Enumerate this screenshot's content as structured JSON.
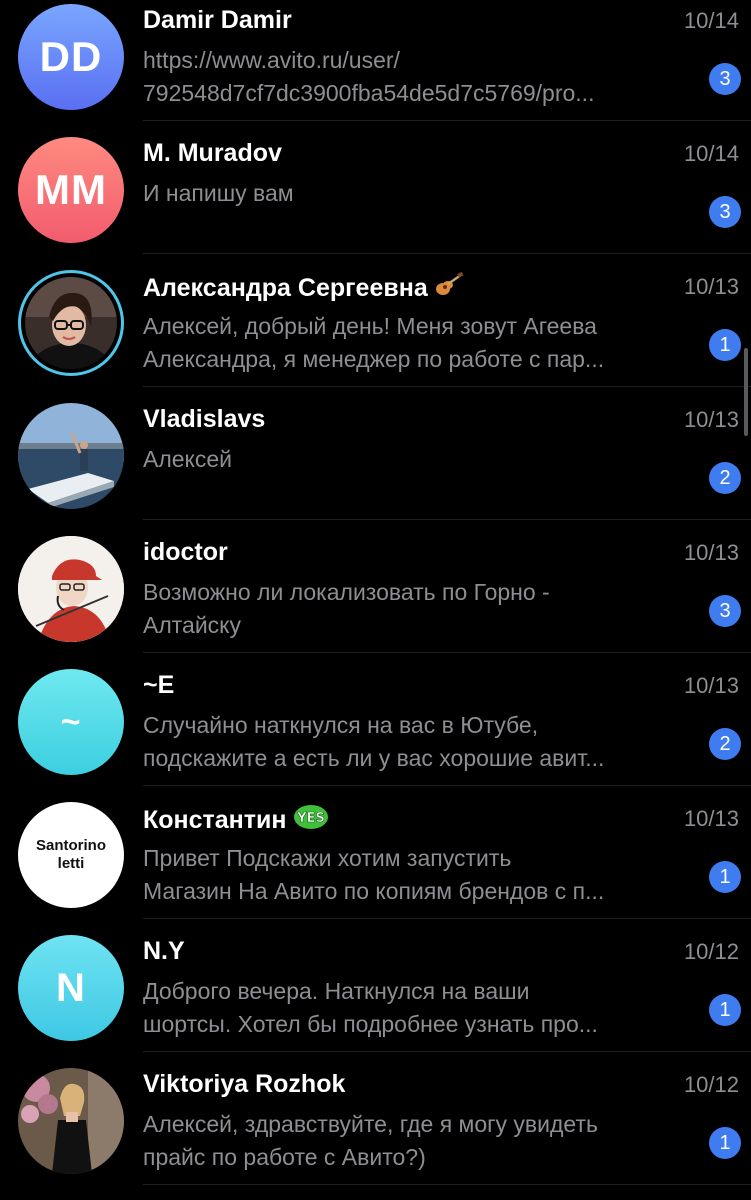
{
  "chats": [
    {
      "name": "Damir Damir",
      "date": "10/14",
      "preview_line1": "https://www.avito.ru/user/",
      "preview_line2": "792548d7cf7dc3900fba54de5d7c5769/pro...",
      "unread": "3",
      "avatar_initials": "DD"
    },
    {
      "name": "M. Muradov",
      "date": "10/14",
      "preview_line1": "И напишу вам",
      "preview_line2": "",
      "unread": "3",
      "avatar_initials": "MM"
    },
    {
      "name": "Александра Сергеевна",
      "date": "10/13",
      "preview_line1": "Алексей, добрый день! Меня зовут Агеева",
      "preview_line2": "Александра, я менеджер по работе с пар...",
      "unread": "1",
      "avatar_icon": "profile-photo-woman-glasses",
      "name_emoji": "guitar-icon"
    },
    {
      "name": "Vladislavs",
      "date": "10/13",
      "preview_line1": "Алексей",
      "preview_line2": "",
      "unread": "2",
      "avatar_icon": "profile-photo-boat"
    },
    {
      "name": "idoctor",
      "date": "10/13",
      "preview_line1": "Возможно ли локализовать по Горно -",
      "preview_line2": "Алтайску",
      "unread": "3",
      "avatar_icon": "profile-illustration-red-cap"
    },
    {
      "name": "~E",
      "date": "10/13",
      "preview_line1": "Случайно наткнулся на вас в Ютубе,",
      "preview_line2": "подскажите а есть ли у вас хорошие авит...",
      "unread": "2",
      "avatar_initials": "~"
    },
    {
      "name": "Константин",
      "date": "10/13",
      "preview_line1": "Привет Подскажи хотим запустить",
      "preview_line2": "Магазин На Авито по копиям брендов с п...",
      "unread": "1",
      "avatar_text_line1": "Santorino",
      "avatar_text_line2": "letti",
      "name_emoji": "yes-sticker-icon"
    },
    {
      "name": "N.Y",
      "date": "10/12",
      "preview_line1": "Доброго вечера. Наткнулся на ваши",
      "preview_line2": "шортсы. Хотел бы подробнее узнать про...",
      "unread": "1",
      "avatar_initials": "N"
    },
    {
      "name": "Viktoriya Rozhok",
      "date": "10/12",
      "preview_line1": "Алексей, здравствуйте, где я могу увидеть",
      "preview_line2": "прайс по работе с Авито?)",
      "unread": "1",
      "avatar_icon": "profile-photo-woman-dress"
    }
  ],
  "colors": {
    "background": "#000000",
    "badge": "#3e7cf0",
    "secondary_text": "#8e8e93"
  }
}
